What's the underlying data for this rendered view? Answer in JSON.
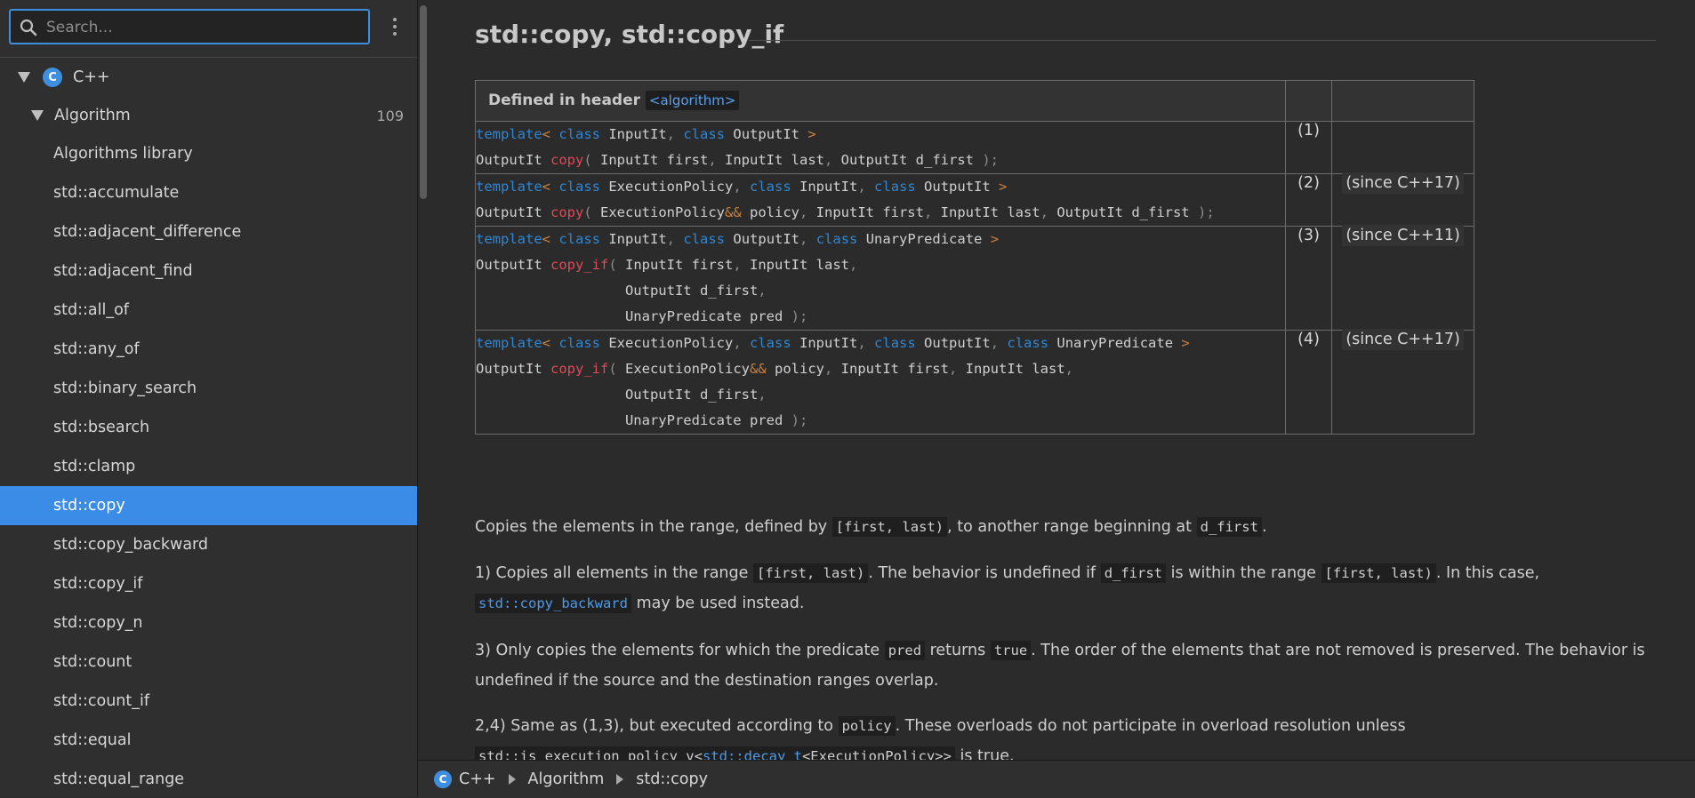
{
  "search": {
    "placeholder": "Search..."
  },
  "sidebar": {
    "root": {
      "label": "C++",
      "logo_text": "C"
    },
    "group": {
      "label": "Algorithm",
      "count": "109"
    },
    "items": [
      {
        "label": "Algorithms library"
      },
      {
        "label": "std::accumulate"
      },
      {
        "label": "std::adjacent_difference"
      },
      {
        "label": "std::adjacent_find"
      },
      {
        "label": "std::all_of"
      },
      {
        "label": "std::any_of"
      },
      {
        "label": "std::binary_search"
      },
      {
        "label": "std::bsearch"
      },
      {
        "label": "std::clamp"
      },
      {
        "label": "std::copy",
        "active": true
      },
      {
        "label": "std::copy_backward"
      },
      {
        "label": "std::copy_if"
      },
      {
        "label": "std::copy_n"
      },
      {
        "label": "std::count"
      },
      {
        "label": "std::count_if"
      },
      {
        "label": "std::equal"
      },
      {
        "label": "std::equal_range"
      }
    ]
  },
  "page": {
    "title": "std::copy, std::copy_if",
    "header_prefix": "Defined in header",
    "header_code": "<algorithm>",
    "overloads": [
      {
        "num": "(1)",
        "since": ""
      },
      {
        "num": "(2)",
        "since": "(since C++17)"
      },
      {
        "num": "(3)",
        "since": "(since C++11)"
      },
      {
        "num": "(4)",
        "since": "(since C++17)"
      }
    ],
    "desc1": {
      "a": "Copies the elements in the range, defined by",
      "code1": "[first, last)",
      "b": ", to another range beginning at",
      "code2": "d_first",
      "c": "."
    },
    "desc2": {
      "a": "1) Copies all elements in the range",
      "code1": "[first, last)",
      "b": ". The behavior is undefined if",
      "code2": "d_first",
      "c": "is within the range",
      "code3": "[first, last)",
      "d": ". In this case,",
      "link": "std::copy_backward",
      "e": "may be used instead."
    },
    "desc3": {
      "a": "3) Only copies the elements for which the predicate",
      "code1": "pred",
      "b": "returns",
      "code2": "true",
      "c": ". The order of the elements that are not removed is preserved. The behavior is undefined if the source and the destination ranges overlap."
    },
    "desc4": {
      "a": "2,4) Same as (1,3), but executed according to",
      "code1": "policy",
      "b": ". These overloads do not participate in overload resolution unless",
      "code2": "std::is_execution_policy_v<",
      "link": "std::decay_t",
      "code3": "<ExecutionPolicy>>",
      "c": "is true."
    }
  },
  "breadcrumb": [
    "C++",
    "Algorithm",
    "std::copy"
  ],
  "colors": {
    "accent": "#3b8ce6",
    "keyword": "#2f86d2",
    "function": "#e04a56",
    "operator": "#c9803e"
  }
}
